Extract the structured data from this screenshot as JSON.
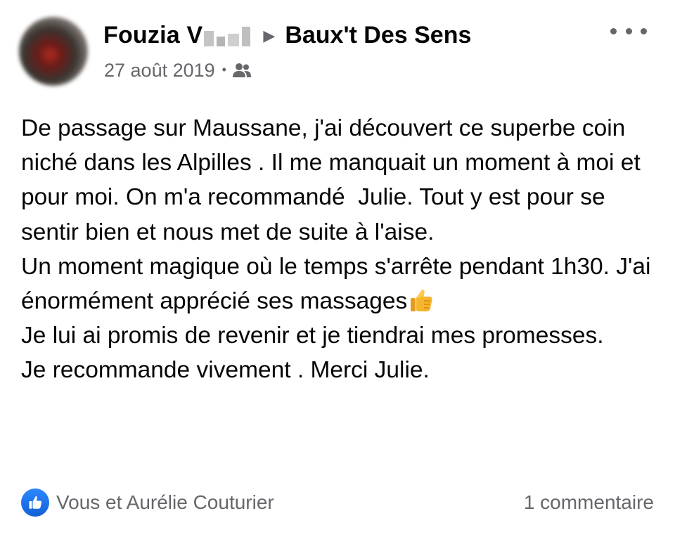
{
  "post": {
    "author": "Fouzia V",
    "group": "Baux't Des Sens",
    "date": "27 août 2019",
    "separator": "•",
    "audience_icon": "group-icon",
    "more_icon": "more-horizontal-icon",
    "paragraphs": [
      "De passage sur Maussane, j'ai découvert ce superbe coin niché dans les Alpilles . Il me manquait un moment à moi et pour moi. On m'a recommandé  Julie. Tout y est pour se sentir bien et nous met de suite à l'aise.",
      "Un moment magique où le temps s'arrête pendant 1h30. J'ai énormément apprécié ses massages",
      "Je lui ai promis de revenir et je tiendrai mes promesses.",
      "Je recommande vivement . Merci Julie."
    ],
    "emoji": "thumbs-up-emoji",
    "reactions": "Vous et Aurélie Couturier",
    "reaction_icon": "like-icon",
    "comments": "1 commentaire"
  },
  "colors": {
    "text": "#050505",
    "secondary": "#65676b",
    "like_blue": "#1877f2"
  }
}
